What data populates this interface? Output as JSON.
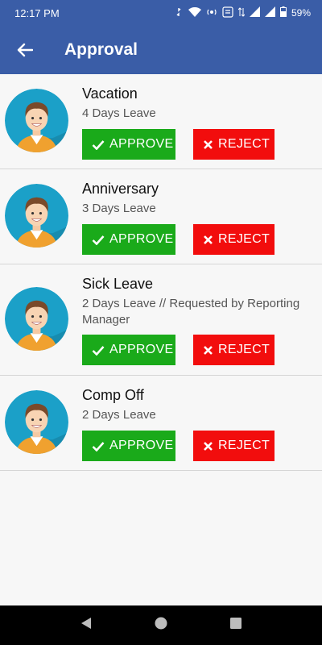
{
  "status": {
    "time": "12:17 PM",
    "battery": "59%",
    "icons": [
      "sync-icon",
      "wifi-icon",
      "hotspot-icon",
      "volte-icon",
      "data-arrows-icon",
      "signal-icon",
      "signal-icon",
      "battery-icon"
    ]
  },
  "header": {
    "title": "Approval"
  },
  "requests": [
    {
      "name": "Vacation",
      "detail": "4 Days Leave",
      "approve": "APPROVE",
      "reject": "REJECT"
    },
    {
      "name": "Anniversary",
      "detail": "3 Days Leave",
      "approve": "APPROVE",
      "reject": "REJECT"
    },
    {
      "name": "Sick Leave",
      "detail": "2 Days Leave // Requested by Reporting Manager",
      "approve": "APPROVE",
      "reject": "REJECT"
    },
    {
      "name": "Comp Off",
      "detail": "2 Days Leave",
      "approve": "APPROVE",
      "reject": "REJECT"
    }
  ],
  "colors": {
    "app_bar": "#3a5da7",
    "approve": "#1aaa1a",
    "reject": "#f20d0d",
    "avatar_bg": "#1ba0c8"
  }
}
